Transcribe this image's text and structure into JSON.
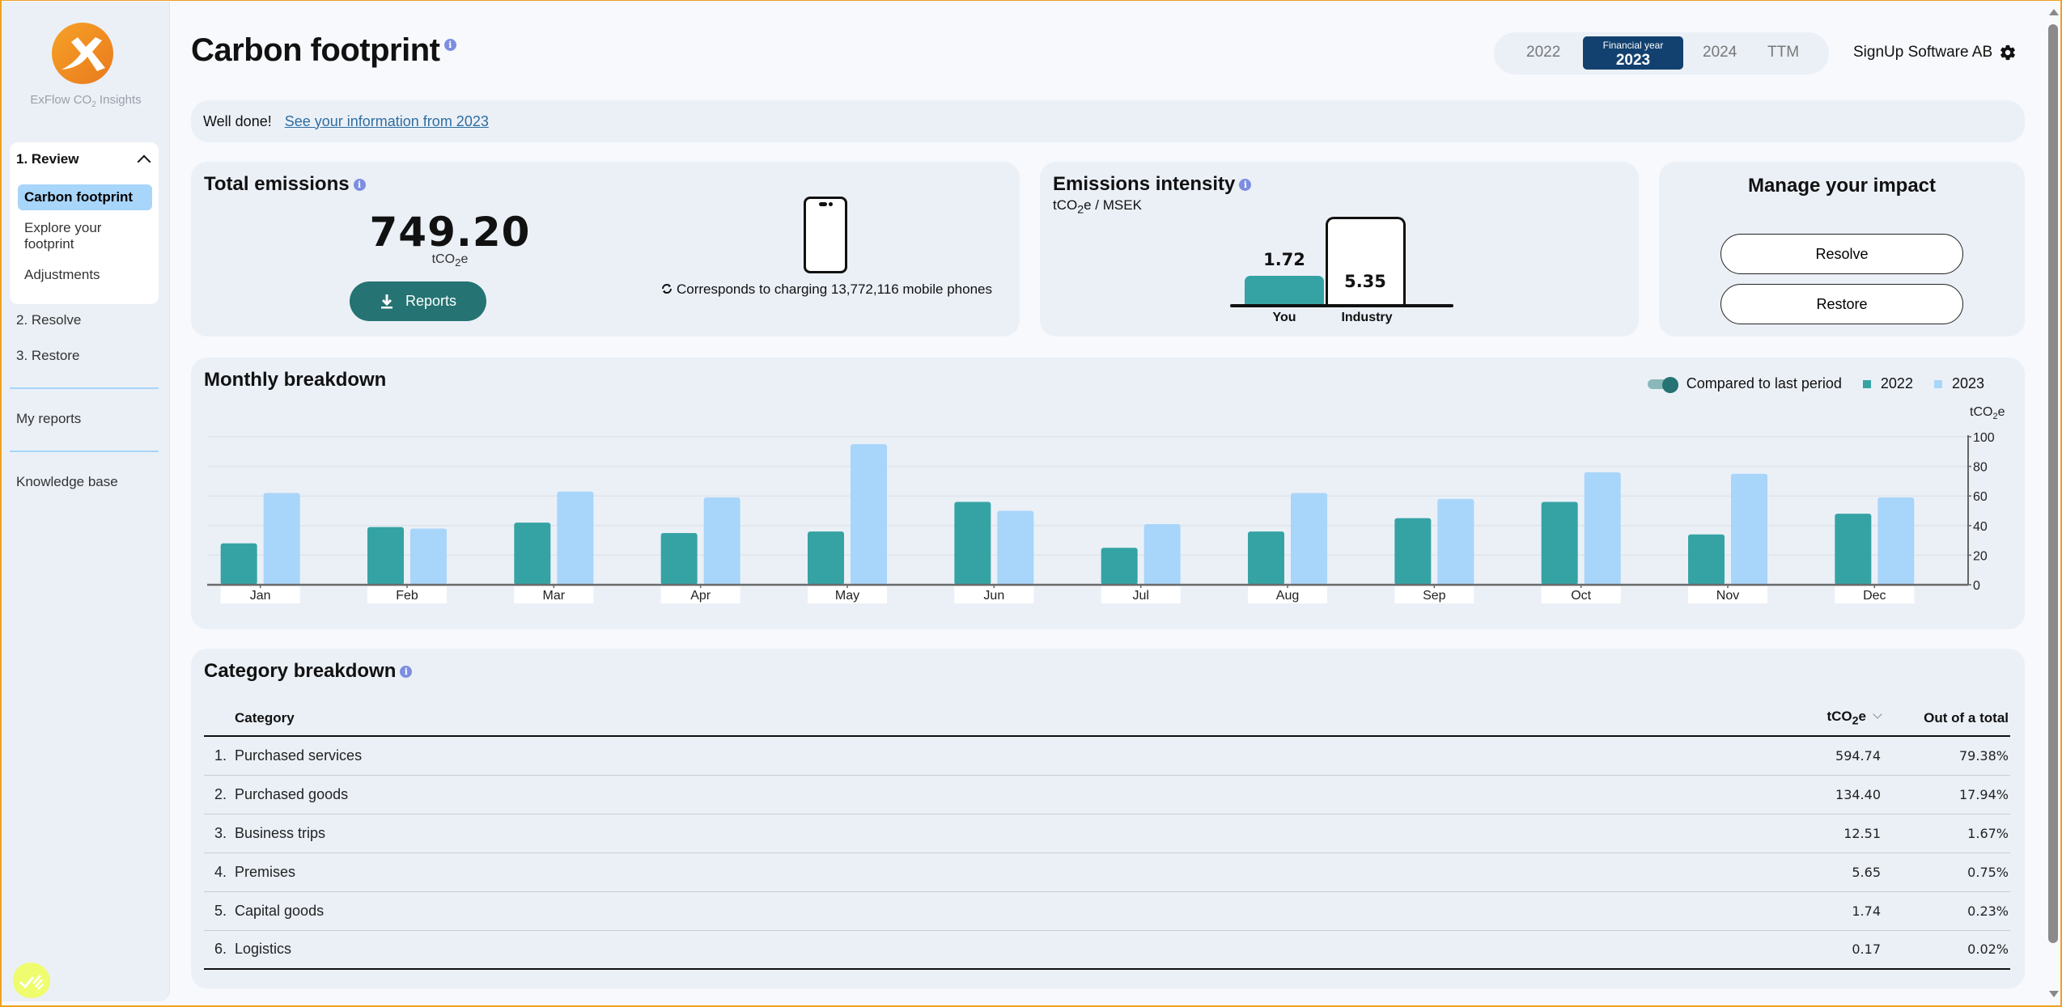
{
  "app": {
    "name_prefix": "ExFlow CO",
    "name_sub": "2",
    "name_suffix": " Insights"
  },
  "sidebar": {
    "group": {
      "label": "1. Review",
      "items": [
        {
          "label": "Carbon footprint",
          "active": true
        },
        {
          "label": "Explore your footprint",
          "active": false
        },
        {
          "label": "Adjustments",
          "active": false
        }
      ]
    },
    "items": [
      {
        "label": "2. Resolve"
      },
      {
        "label": "3. Restore"
      },
      {
        "label": "My reports"
      },
      {
        "label": "Knowledge base"
      }
    ]
  },
  "header": {
    "title": "Carbon footprint",
    "years": [
      "2022",
      "2024",
      "TTM"
    ],
    "active_year_caption": "Financial year",
    "active_year": "2023",
    "company": "SignUp Software AB"
  },
  "banner": {
    "text": "Well done!",
    "link": "See your information from 2023"
  },
  "total": {
    "title": "Total emissions",
    "value": "749.20",
    "unit_prefix": "tCO",
    "unit_sub": "2",
    "unit_suffix": "e",
    "reports_label": "Reports",
    "equivalence": "Corresponds to charging 13,772,116 mobile phones"
  },
  "intensity": {
    "title": "Emissions intensity",
    "unit_prefix": "tCO",
    "unit_sub": "2",
    "unit_suffix": "e / MSEK",
    "you_value": 1.72,
    "you_label_value": "1.72",
    "industry_value": 5.35,
    "industry_label_value": "5.35",
    "you_label": "You",
    "industry_label": "Industry"
  },
  "manage": {
    "title": "Manage your impact",
    "resolve_label": "Resolve",
    "restore_label": "Restore"
  },
  "monthly": {
    "title": "Monthly breakdown",
    "toggle_label": "Compared to last period",
    "toggle_on": true
  },
  "chart_data": {
    "type": "bar",
    "title": "Monthly breakdown",
    "categories": [
      "Jan",
      "Feb",
      "Mar",
      "Apr",
      "May",
      "Jun",
      "Jul",
      "Aug",
      "Sep",
      "Oct",
      "Nov",
      "Dec"
    ],
    "series": [
      {
        "name": "2022",
        "color": "#35a3a4",
        "values": [
          28,
          39,
          42,
          35,
          36,
          56,
          25,
          36,
          45,
          56,
          34,
          48
        ]
      },
      {
        "name": "2023",
        "color": "#a8d5fa",
        "values": [
          62,
          38,
          63,
          59,
          95,
          50,
          41,
          62,
          58,
          76,
          75,
          59
        ]
      }
    ],
    "ylabel": "tCO2e",
    "yticks": [
      0,
      20,
      40,
      60,
      80,
      100
    ],
    "ylim": [
      0,
      100
    ],
    "y_axis_side": "right",
    "grid": true,
    "legend": "top-right"
  },
  "category": {
    "title": "Category breakdown",
    "columns": {
      "category": "Category",
      "tco2e_prefix": "tCO",
      "tco2e_sub": "2",
      "tco2e_suffix": "e",
      "share": "Out of a total"
    },
    "rows": [
      {
        "index": "1.",
        "name": "Purchased services",
        "tco2e": "594.74",
        "share": "79.38%"
      },
      {
        "index": "2.",
        "name": "Purchased goods",
        "tco2e": "134.40",
        "share": "17.94%"
      },
      {
        "index": "3.",
        "name": "Business trips",
        "tco2e": "12.51",
        "share": "1.67%"
      },
      {
        "index": "4.",
        "name": "Premises",
        "tco2e": "5.65",
        "share": "0.75%"
      },
      {
        "index": "5.",
        "name": "Capital goods",
        "tco2e": "1.74",
        "share": "0.23%"
      },
      {
        "index": "6.",
        "name": "Logistics",
        "tco2e": "0.17",
        "share": "0.02%"
      }
    ]
  },
  "colors": {
    "accent": "#257373",
    "teal": "#35a3a4",
    "light_blue": "#a8d5fa",
    "navy": "#12416f",
    "info": "#7d8ee0",
    "logo_orange": "#f0901e",
    "chat_yellow": "#eefc6e"
  }
}
